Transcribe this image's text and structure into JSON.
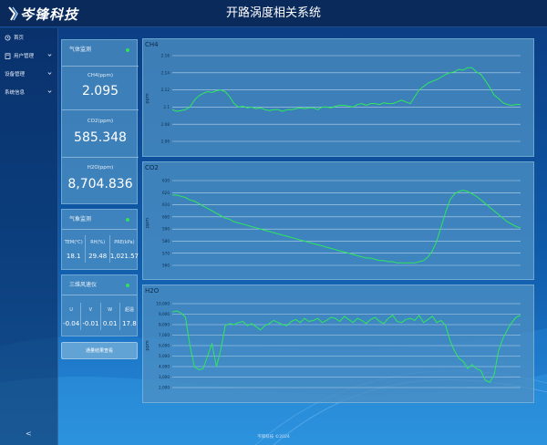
{
  "header": {
    "logo_text": "岑锋科技",
    "title": "开路涡度相关系统"
  },
  "sidebar": {
    "items": [
      {
        "label": "首页",
        "icon": "home-icon",
        "has_children": false
      },
      {
        "label": "用户管理",
        "icon": "document-icon",
        "has_children": true
      },
      {
        "label": "设备管理",
        "icon": "",
        "has_children": true
      },
      {
        "label": "系统信息",
        "icon": "",
        "has_children": true
      }
    ],
    "collapse_label": "<"
  },
  "gas_panel": {
    "title": "气体监测",
    "items": [
      {
        "label": "CH4(ppm)",
        "value": "2.095"
      },
      {
        "label": "CO2(ppm)",
        "value": "585.348"
      },
      {
        "label": "H2O(ppm)",
        "value": "8,704.836"
      }
    ]
  },
  "met_panel": {
    "title": "气象监测",
    "headers": [
      "TEM(℃)",
      "RH(%)",
      "PRE(kPa)"
    ],
    "values": [
      "18.1",
      "29.48",
      "1,021.57"
    ]
  },
  "wind_panel": {
    "title": "三维风速仪",
    "headers": [
      "U",
      "V",
      "W",
      "超温"
    ],
    "values": [
      "-0.04",
      "-0.01",
      "0.01",
      "17.8"
    ]
  },
  "history_button": "通量结果查看",
  "footer": "岑锋科技 ©2024",
  "colors": {
    "accent_line": "#2ee85a",
    "status_dot": "#30e05a",
    "panel_bg": "#4c90c4"
  },
  "chart_data": [
    {
      "type": "line",
      "title": "CH4",
      "ylabel": "ppm",
      "yticks": [
        "2.16",
        "2.14",
        "2.12",
        "2.1",
        "2.08",
        "2.06"
      ],
      "ylim": [
        2.06,
        2.16
      ],
      "series": [
        {
          "values": [
            2.097,
            2.095,
            2.096,
            2.097,
            2.1,
            2.108,
            2.113,
            2.116,
            2.118,
            2.117,
            2.119,
            2.12,
            2.118,
            2.112,
            2.104,
            2.1,
            2.101,
            2.099,
            2.1,
            2.098,
            2.099,
            2.097,
            2.096,
            2.097,
            2.097,
            2.095,
            2.097,
            2.097,
            2.098,
            2.099,
            2.098,
            2.099,
            2.099,
            2.097,
            2.1,
            2.1,
            2.099,
            2.101,
            2.102,
            2.102,
            2.101,
            2.1,
            2.103,
            2.104,
            2.102,
            2.104,
            2.104,
            2.103,
            2.105,
            2.104,
            2.104,
            2.106,
            2.108,
            2.106,
            2.104,
            2.112,
            2.12,
            2.124,
            2.128,
            2.13,
            2.132,
            2.135,
            2.138,
            2.14,
            2.141,
            2.144,
            2.143,
            2.146,
            2.146,
            2.141,
            2.138,
            2.131,
            2.123,
            2.114,
            2.11,
            2.105,
            2.103,
            2.102,
            2.103,
            2.103
          ]
        }
      ]
    },
    {
      "type": "line",
      "title": "CO2",
      "ylabel": "ppm",
      "yticks": [
        "630",
        "620",
        "610",
        "600",
        "590",
        "580",
        "570",
        "560"
      ],
      "ylim": [
        560,
        630
      ],
      "series": [
        {
          "values": [
            618,
            618,
            617,
            616,
            614,
            613,
            611,
            609,
            607,
            605,
            603,
            601,
            599,
            598,
            596,
            595,
            594,
            593,
            592,
            591,
            590,
            589,
            588,
            587,
            586,
            585,
            584,
            583,
            582,
            581,
            580,
            579,
            578,
            577,
            576,
            575,
            574,
            573,
            572,
            571,
            570,
            569,
            568,
            567,
            566,
            566,
            565,
            564,
            564,
            563,
            563,
            562,
            562,
            562,
            562,
            562,
            563,
            564,
            567,
            572,
            580,
            592,
            604,
            614,
            619,
            621,
            622,
            621,
            619,
            617,
            614,
            611,
            608,
            605,
            602,
            599,
            596,
            594,
            592,
            591
          ]
        }
      ]
    },
    {
      "type": "line",
      "title": "H2O",
      "ylabel": "ppm",
      "yticks": [
        "10,000",
        "9,000",
        "8,000",
        "7,000",
        "6,000",
        "5,000",
        "4,000",
        "3,000",
        "2,000"
      ],
      "ylim": [
        2000,
        10000
      ],
      "series": [
        {
          "values": [
            9200,
            9300,
            9100,
            8700,
            6000,
            4000,
            3700,
            3800,
            5000,
            6200,
            4000,
            5600,
            7900,
            8100,
            8000,
            8200,
            8300,
            7900,
            8100,
            7800,
            7500,
            7900,
            8100,
            8400,
            8200,
            8000,
            7900,
            8300,
            8500,
            8200,
            8600,
            8300,
            8400,
            8600,
            8200,
            8400,
            8700,
            8600,
            8300,
            8800,
            8500,
            8200,
            8600,
            8400,
            8100,
            8500,
            8700,
            8300,
            8100,
            8600,
            8900,
            8300,
            8200,
            8500,
            8600,
            8400,
            8900,
            8200,
            8500,
            8800,
            8200,
            8400,
            7900,
            6500,
            5500,
            4800,
            4500,
            3800,
            4200,
            3800,
            3600,
            2700,
            2500,
            3200,
            5500,
            6700,
            7500,
            8200,
            8700,
            8900
          ]
        }
      ]
    }
  ]
}
